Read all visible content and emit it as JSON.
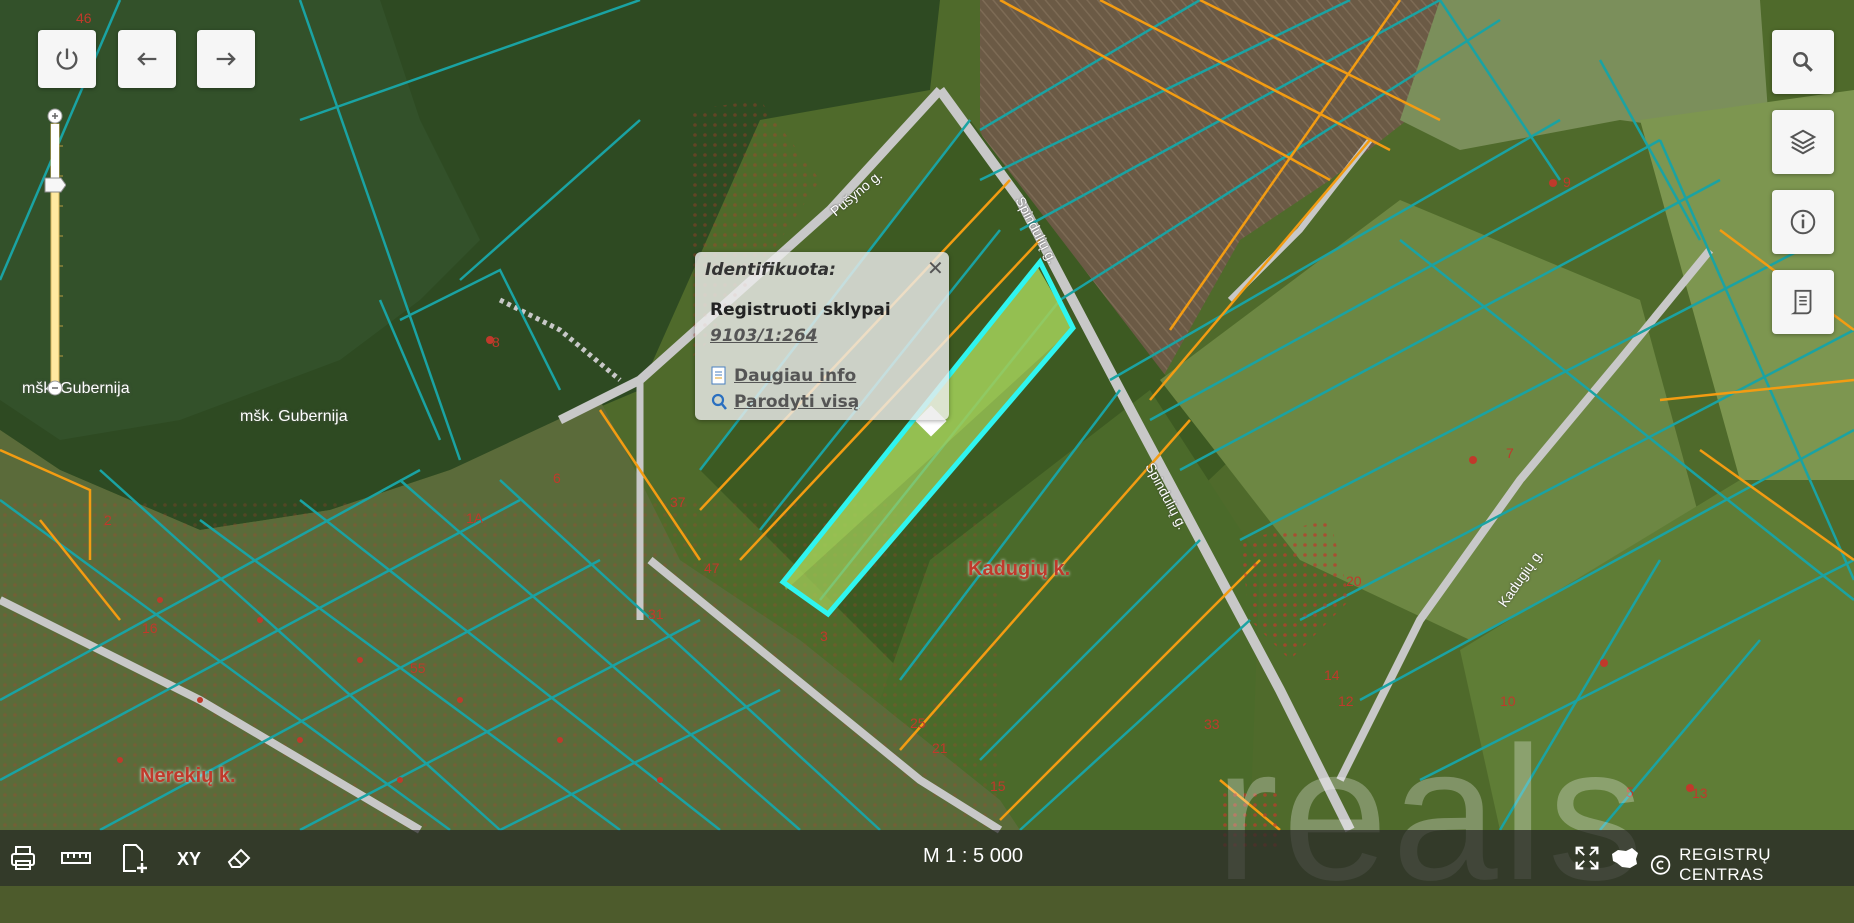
{
  "map": {
    "place_labels": [
      "mšk. Gubernija",
      "mšk. Gubernija",
      "Kadugių k.",
      "Nerekių k."
    ],
    "street_labels": [
      "Pušyno g.",
      "Spindulių g.",
      "Spindulių g.",
      "Kadugių g."
    ],
    "parcel_numbers": [
      "46",
      "8",
      "6",
      "2",
      "9",
      "7",
      "10",
      "13",
      "20",
      "14",
      "12",
      "33",
      "37",
      "31",
      "3",
      "1A",
      "47",
      "16",
      "55",
      "21",
      "25",
      "15",
      "5"
    ],
    "watermark": "reals"
  },
  "popup": {
    "heading": "Identifikuota:",
    "close_symbol": "✕",
    "layer_title": "Registruoti sklypai",
    "parcel_id": "9103/1:264",
    "more_info": "Daugiau info",
    "show_all": "Parodyti visą"
  },
  "toolbar": {
    "scale": "M 1 : 5 000",
    "brand": "REGISTRŲ CENTRAS"
  },
  "colors": {
    "parcel_teal": "#1aa3a3",
    "parcel_orange": "#f39c12",
    "selected_parcel": "#2ff5f0",
    "road": "#c8c8c8",
    "forest": "#2f4a1f",
    "field_green": "#5a7a2e"
  },
  "icons": [
    "power-icon",
    "undo-icon",
    "redo-icon",
    "search-icon",
    "layers-icon",
    "info-icon",
    "legend-icon",
    "print-icon",
    "measure-icon",
    "add-document-icon",
    "xy-coordinates-icon",
    "eraser-icon",
    "fullscreen-icon",
    "lithuania-map-icon",
    "copyright-icon"
  ]
}
